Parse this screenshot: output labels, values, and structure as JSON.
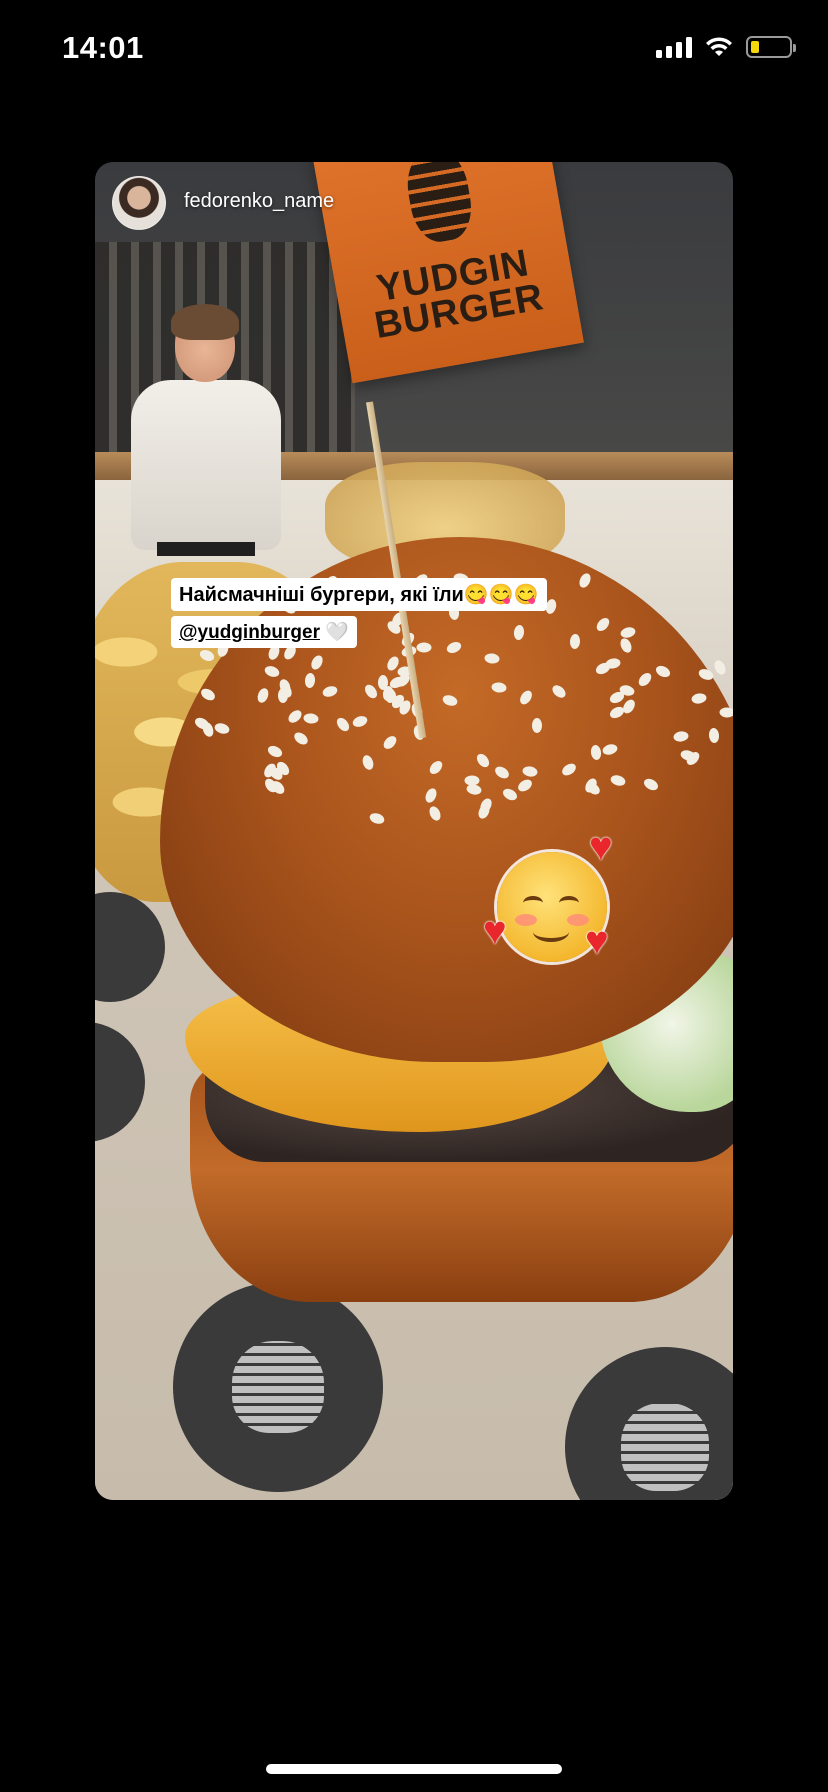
{
  "status_bar": {
    "time": "14:01",
    "battery_color": "#f5d60a",
    "icons": [
      "signal-icon",
      "wifi-icon",
      "battery-icon"
    ]
  },
  "story": {
    "username": "fedorenko_name",
    "flag_text_line1": "YUDGIN",
    "flag_text_line2": "BURGER",
    "caption_line1": "Найсмачніші бургери, які їли😋😋😋",
    "mention": "@yudginburger",
    "mention_suffix": " 🤍"
  }
}
